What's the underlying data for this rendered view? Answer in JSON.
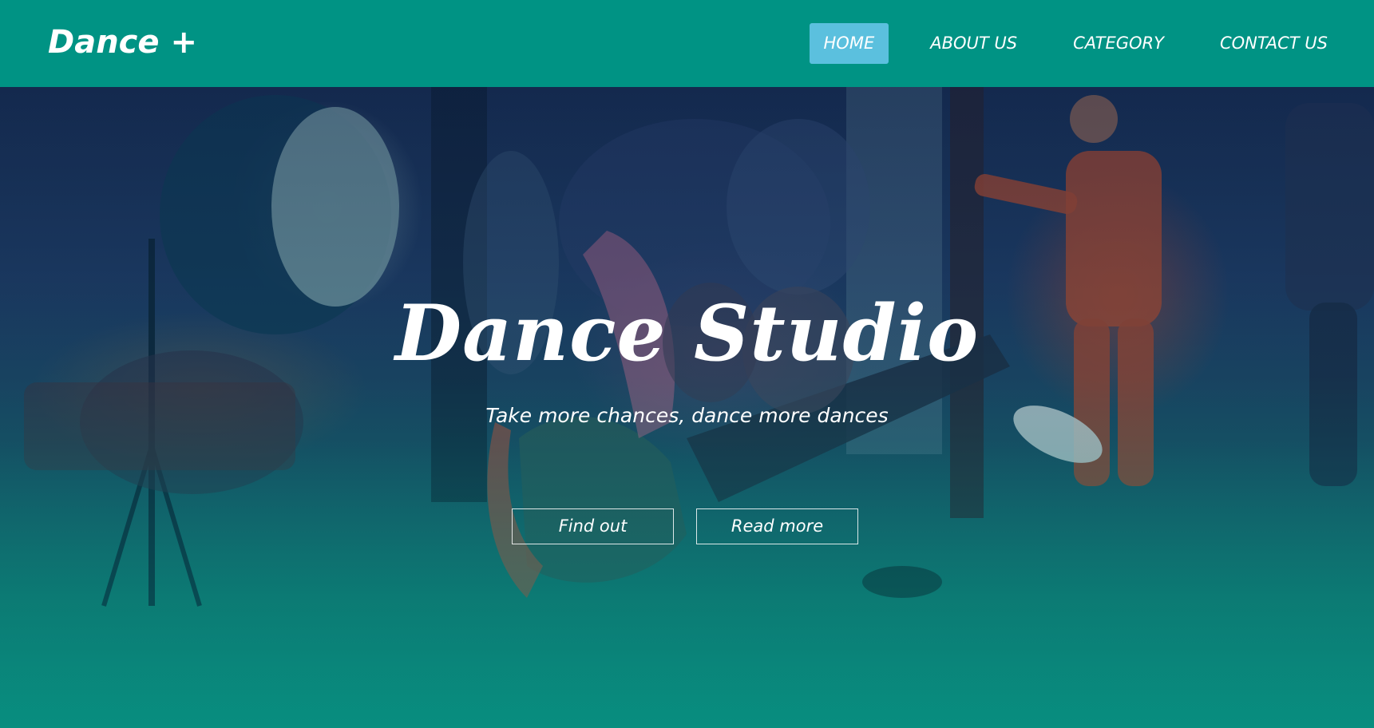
{
  "header": {
    "logo": "Dance +",
    "nav": [
      {
        "label": "HOME",
        "active": true
      },
      {
        "label": "ABOUT US",
        "active": false
      },
      {
        "label": "CATEGORY",
        "active": false
      },
      {
        "label": "CONTACT US",
        "active": false
      }
    ]
  },
  "hero": {
    "title": "Dance Studio",
    "subtitle": "Take more chances, dance more dances",
    "buttons": {
      "find_out": "Find out",
      "read_more": "Read more"
    }
  },
  "colors": {
    "header_bg": "#009384",
    "nav_active_bg": "#5bc0de",
    "text": "#ffffff"
  }
}
